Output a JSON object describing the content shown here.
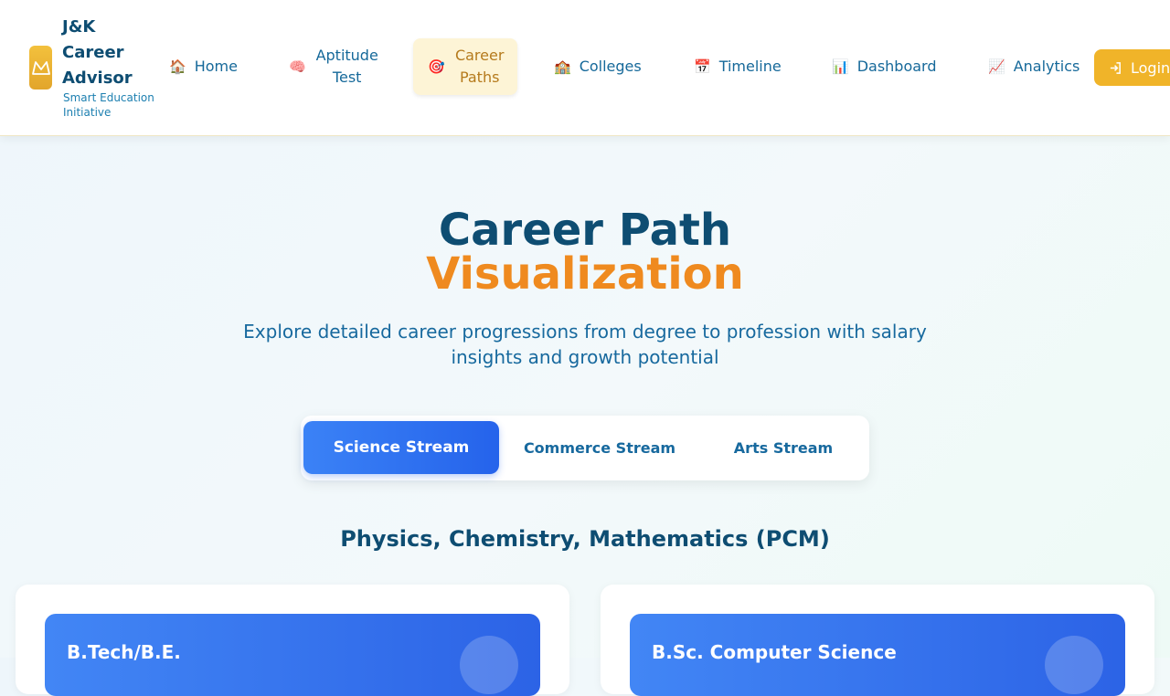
{
  "brand": {
    "title": "J&K Career Advisor",
    "subtitle": "Smart Education Initiative",
    "logo_icon": "mountain-icon"
  },
  "nav": {
    "items": [
      {
        "icon": "🏠",
        "label": "Home"
      },
      {
        "icon": "🧠",
        "label": "Aptitude Test"
      },
      {
        "icon": "🎯",
        "label": "Career Paths",
        "active": true
      },
      {
        "icon": "🏫",
        "label": "Colleges"
      },
      {
        "icon": "📅",
        "label": "Timeline"
      },
      {
        "icon": "📊",
        "label": "Dashboard"
      },
      {
        "icon": "📈",
        "label": "Analytics"
      }
    ],
    "login_label": "Login",
    "login_icon": "login-icon"
  },
  "hero": {
    "title_line1": "Career Path",
    "title_line2": "Visualization",
    "subtitle": "Explore detailed career progressions from degree to profession with salary insights and growth potential"
  },
  "tabs": [
    {
      "label": "Science Stream",
      "active": true
    },
    {
      "label": "Commerce Stream"
    },
    {
      "label": "Arts Stream"
    }
  ],
  "section": {
    "heading": "Physics, Chemistry, Mathematics (PCM)"
  },
  "cards": [
    {
      "title": "B.Tech/B.E."
    },
    {
      "title": "B.Sc. Computer Science"
    }
  ],
  "colors": {
    "primary_dark": "#0e4d72",
    "accent_orange": "#ef8a1f",
    "brand_yellow": "#f0b429",
    "tab_blue": "#2563eb"
  }
}
